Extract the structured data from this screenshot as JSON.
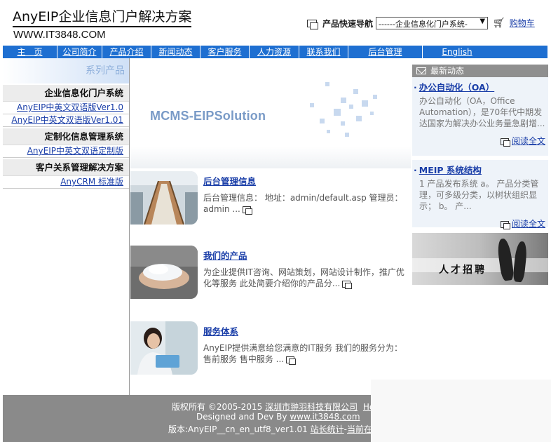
{
  "header": {
    "title": "AnyEIP企业信息门户解决方案",
    "url": "WWW.IT3848.COM",
    "quicknav_label": "产品快速导航",
    "quicknav_value": "------企业信息化门户系统-",
    "cart_label": "购物车"
  },
  "nav": {
    "items": [
      "主　页",
      "公司简介",
      "产品介绍",
      "新闻动态",
      "客户服务",
      "人力资源",
      "联系我们",
      "后台管理",
      "English"
    ]
  },
  "sidebar": {
    "heading": "系列产品",
    "cat1": "企业信息化门户系统",
    "cat1_links": [
      "AnyEIP中英文双语版Ver1.0",
      "AnyEIP中英文双语版Ver1.01"
    ],
    "cat2": "定制化信息管理系统",
    "cat2_links": [
      "AnyEIP中英文双语定制版"
    ],
    "cat3": "客户关系管理解决方案",
    "cat3_links": [
      "AnyCRM 标准版"
    ]
  },
  "banner": {
    "text": "MCMS-EIPSolution"
  },
  "items": [
    {
      "title": "后台管理信息",
      "desc": "后台管理信息： 地址：admin/default.asp 管理员：admin ..."
    },
    {
      "title": "我们的产品",
      "desc": "为企业提供IT咨询、网站策划，网站设计制作，推广优化等服务 此处简要介绍你的产品分..."
    },
    {
      "title": "服务体系",
      "desc": "AnyEIP提供满意给您满意的IT服务 我们的服务分为：售前服务 售中服务 ..."
    }
  ],
  "news": {
    "heading": "最新动态",
    "entries": [
      {
        "title": "办公自动化（OA）",
        "body": "办公自动化（OA，Office Automation），是70年代中期发达国家为解决办公业务量急剧增...",
        "more": "阅读全文"
      },
      {
        "title": "MEIP 系统结构",
        "body": "1 产品发布系统 a。 产品分类管理，可多级分类，以树状组织显示； b。 产...",
        "more": "阅读全文"
      }
    ]
  },
  "recruit": {
    "text": "人才招聘"
  },
  "footer": {
    "copyright": "版权所有 ©2005-2015",
    "company": "深圳市翀羽科技有限公司",
    "help": "He",
    "designed": "Designed and Dev By",
    "site": "www.it3848.com",
    "version": "版本:AnyEIP__cn_en_utf8_ver1.01",
    "stats": "站长统计",
    "sep": "-",
    "online": "当前在线"
  },
  "colors": {
    "nav_bg": "#1e6fd1",
    "footer_bg": "#8a8a8a",
    "link": "#1a3ea8"
  }
}
